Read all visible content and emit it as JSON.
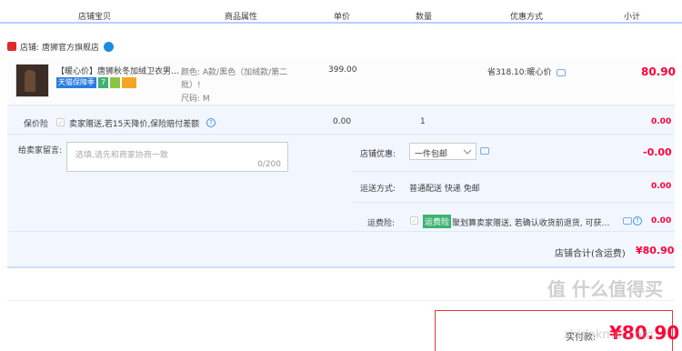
{
  "columns": [
    "店铺宝贝",
    "商品属性",
    "单价",
    "数量",
    "优惠方式",
    "小计"
  ],
  "shop": {
    "label": "店铺:",
    "name": "唐狮官方旗舰店"
  },
  "item": {
    "title": "【暖心价】唐狮秋冬加绒卫衣男…",
    "badge_tmall": "天猫保障季",
    "badge_7": "7",
    "attr_color": "颜色: A款/黑色（加绒款/第二",
    "attr_color2": "批）!",
    "attr_size": "尺码: M",
    "price": "399.00",
    "discount": "省318.10:暖心价",
    "subtotal": "80.90"
  },
  "insurance": {
    "label": "保价险",
    "text": "卖家赠送,若15天降价,保险赔付差额",
    "price": "0.00",
    "qty": "1",
    "subtotal": "0.00"
  },
  "memo": {
    "label": "给卖家留言:",
    "placeholder": "选填,请先和商家协商一致",
    "counter": "0/200"
  },
  "shop_discount": {
    "label": "店铺优惠:",
    "selected": "一件包邮",
    "amount": "-0.00"
  },
  "shipping": {
    "label": "运送方式:",
    "value": "普通配送 快递 免邮",
    "amount": "0.00"
  },
  "freight_insurance": {
    "label": "运费险:",
    "tag": "运费险",
    "text": "聚划算卖家赠送, 若确认收货前退货, 可获…",
    "amount": "0.00"
  },
  "shop_total": {
    "label": "店铺合计(含运费)",
    "amount": "¥80.90"
  },
  "footer": {
    "pay_label": "实付款:",
    "pay_amount": "¥80.90"
  },
  "watermark": {
    "text": "值 什么值得买",
    "url": "zhidekmai.com"
  },
  "colors": {
    "accent": "#ff0036",
    "header_line": "#b2d1ff",
    "panel": "#f2f7ff"
  }
}
